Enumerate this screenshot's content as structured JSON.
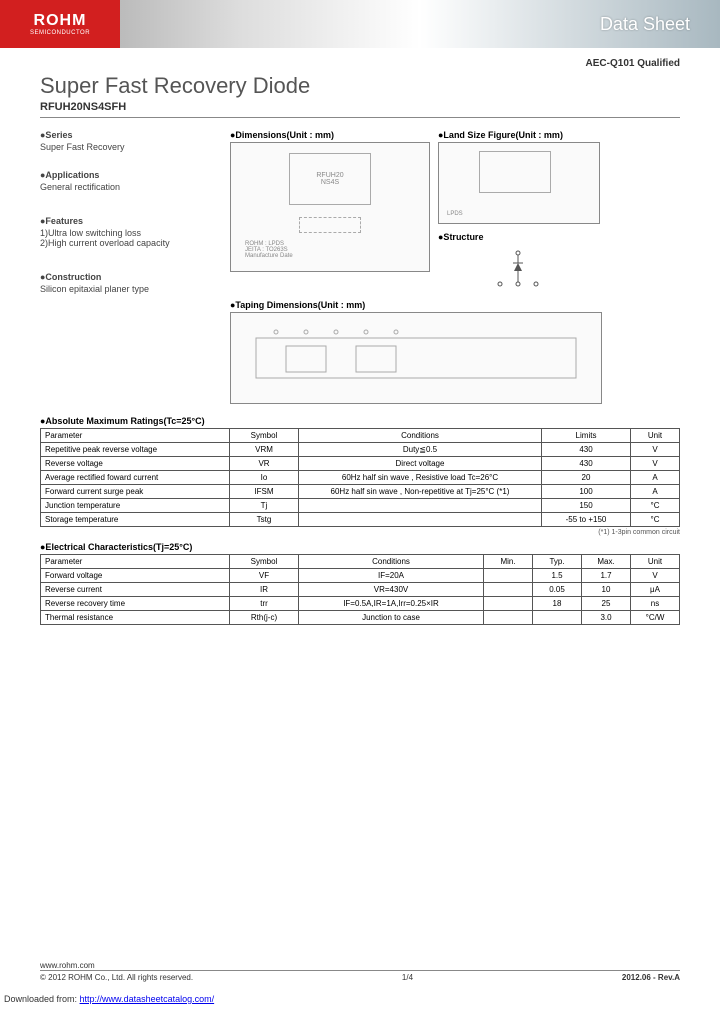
{
  "header": {
    "logo": "ROHM",
    "logo_sub": "SEMICONDUCTOR",
    "banner": "Data Sheet"
  },
  "qualification": "AEC-Q101 Qualified",
  "title": "Super Fast Recovery Diode",
  "part_number": "RFUH20NS4SFH",
  "sections": {
    "series": {
      "head": "●Series",
      "body": "Super Fast Recovery"
    },
    "applications": {
      "head": "●Applications",
      "body": "General rectification"
    },
    "features": {
      "head": "●Features",
      "items": [
        "1)Ultra low switching loss",
        "2)High current overload capacity"
      ]
    },
    "construction": {
      "head": "●Construction",
      "body": "Silicon epitaxial planer type"
    }
  },
  "diagrams": {
    "dimensions": "●Dimensions(Unit : mm)",
    "land_size": "●Land Size Figure(Unit : mm)",
    "structure": "●Structure",
    "taping": "●Taping Dimensions(Unit : mm)",
    "pkg_text": "RFUH20\nNS4S",
    "pkg_note": "ROHM : LPDS\nJEITA : TO263S\nManufacture Date",
    "land_note": "LPDS"
  },
  "abs_max": {
    "title": "●Absolute Maximum Ratings(Tc=25°C)",
    "headers": [
      "Parameter",
      "Symbol",
      "Conditions",
      "Limits",
      "Unit"
    ],
    "rows": [
      {
        "param": "Repetitive peak reverse voltage",
        "sym": "VRM",
        "cond": "Duty≦0.5",
        "lim": "430",
        "unit": "V"
      },
      {
        "param": "Reverse voltage",
        "sym": "VR",
        "cond": "Direct voltage",
        "lim": "430",
        "unit": "V"
      },
      {
        "param": "Average rectified foward current",
        "sym": "Io",
        "cond": "60Hz half sin wave , Resistive load     Tc=26°C",
        "lim": "20",
        "unit": "A"
      },
      {
        "param": "Forward current surge peak",
        "sym": "IFSM",
        "cond": "60Hz half sin wave , Non-repetitive at Tj=25°C (*1)",
        "lim": "100",
        "unit": "A"
      },
      {
        "param": "Junction temperature",
        "sym": "Tj",
        "cond": "",
        "lim": "150",
        "unit": "°C"
      },
      {
        "param": "Storage temperature",
        "sym": "Tstg",
        "cond": "",
        "lim": "-55 to +150",
        "unit": "°C"
      }
    ],
    "footnote": "(*1) 1-3pin common circuit"
  },
  "elec": {
    "title": "●Electrical Characteristics(Tj=25°C)",
    "headers": [
      "Parameter",
      "Symbol",
      "Conditions",
      "Min.",
      "Typ.",
      "Max.",
      "Unit"
    ],
    "rows": [
      {
        "param": "Forward voltage",
        "sym": "VF",
        "cond": "IF=20A",
        "min": "",
        "typ": "1.5",
        "max": "1.7",
        "unit": "V"
      },
      {
        "param": "Reverse current",
        "sym": "IR",
        "cond": "VR=430V",
        "min": "",
        "typ": "0.05",
        "max": "10",
        "unit": "μA"
      },
      {
        "param": "Reverse recovery time",
        "sym": "trr",
        "cond": "IF=0.5A,IR=1A,Irr=0.25×IR",
        "min": "",
        "typ": "18",
        "max": "25",
        "unit": "ns"
      },
      {
        "param": "Thermal resistance",
        "sym": "Rth(j-c)",
        "cond": "Junction to case",
        "min": "",
        "typ": "",
        "max": "3.0",
        "unit": "°C/W"
      }
    ]
  },
  "footer": {
    "url": "www.rohm.com",
    "copyright": "© 2012  ROHM Co., Ltd. All rights reserved.",
    "page": "1/4",
    "rev": "2012.06 - Rev.A"
  },
  "download": {
    "prefix": "Downloaded from: ",
    "link": "http://www.datasheetcatalog.com/"
  }
}
